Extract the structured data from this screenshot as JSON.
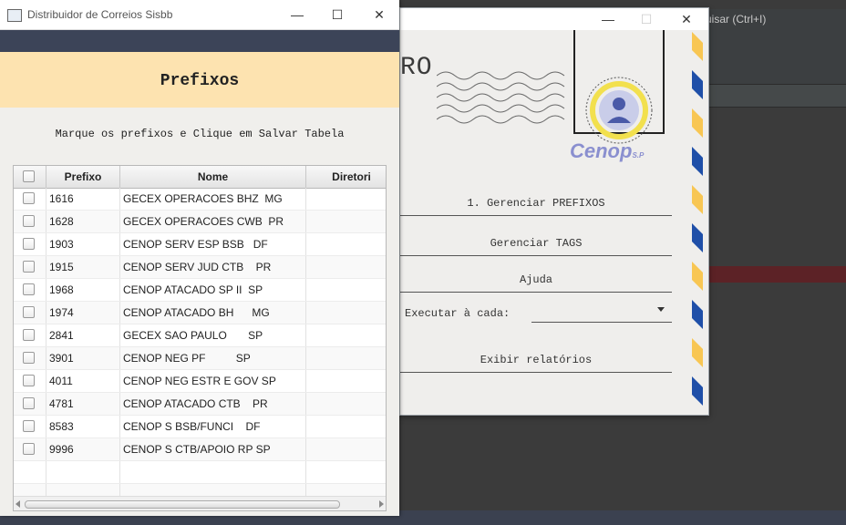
{
  "background_app": {
    "search_hint": "uisar (Ctrl+I)"
  },
  "main_window": {
    "title": "Distribuidor de Correios Sisbb",
    "controls": {
      "minimize": "—",
      "maximize": "☐",
      "close": "✕"
    },
    "page_title": "Prefixos",
    "instructions": "Marque os prefixos e Clique em Salvar Tabela",
    "table": {
      "columns": [
        "",
        "Prefixo",
        "Nome",
        "Diretori"
      ],
      "rows": [
        {
          "prefixo": "1616",
          "nome": "GECEX OPERACOES BHZ  MG",
          "checked": false
        },
        {
          "prefixo": "1628",
          "nome": "GECEX OPERACOES CWB  PR",
          "checked": false
        },
        {
          "prefixo": "1903",
          "nome": "CENOP SERV ESP BSB   DF",
          "checked": false
        },
        {
          "prefixo": "1915",
          "nome": "CENOP SERV JUD CTB    PR",
          "checked": false
        },
        {
          "prefixo": "1968",
          "nome": "CENOP ATACADO SP II  SP",
          "checked": false
        },
        {
          "prefixo": "1974",
          "nome": "CENOP ATACADO BH      MG",
          "checked": false
        },
        {
          "prefixo": "2841",
          "nome": "GECEX SAO PAULO       SP",
          "checked": false
        },
        {
          "prefixo": "3901",
          "nome": "CENOP NEG PF          SP",
          "checked": false
        },
        {
          "prefixo": "4011",
          "nome": "CENOP NEG ESTR E GOV SP",
          "checked": false
        },
        {
          "prefixo": "4781",
          "nome": "CENOP ATACADO CTB    PR",
          "checked": false
        },
        {
          "prefixo": "8583",
          "nome": "CENOP S BSB/FUNCI    DF",
          "checked": false
        },
        {
          "prefixo": "9996",
          "nome": "CENOP S CTB/APOIO RP SP",
          "checked": false
        }
      ]
    }
  },
  "letter_window": {
    "controls": {
      "minimize": "—",
      "maximize": "☐",
      "close": "✕"
    },
    "partial_title": "RO",
    "logo_text": "Cenop",
    "logo_suffix": "S.P",
    "menu": {
      "item1": "1. Gerenciar PREFIXOS",
      "item2": "Gerenciar TAGS",
      "item3": "Ajuda",
      "execute_label": "Executar à cada:",
      "execute_value": "",
      "item5": "Exibir relatórios"
    }
  },
  "colors": {
    "header_bg": "#fde3b0",
    "navbar": "#3c4458",
    "stripe_blue": "#1f4fa8",
    "stripe_yellow": "#f8c653"
  }
}
